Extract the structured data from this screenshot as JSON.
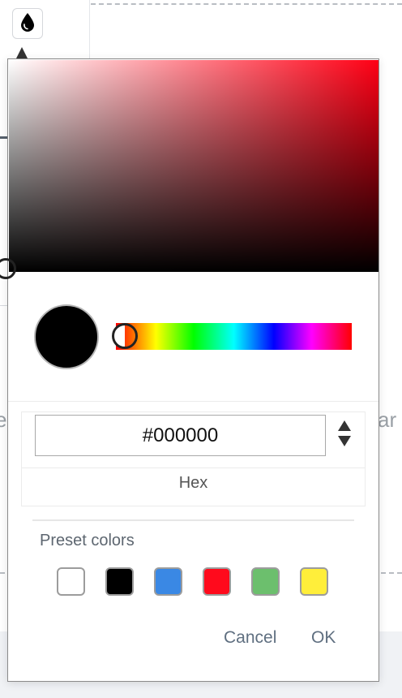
{
  "background": {
    "left_text": "e",
    "right_text": "ar"
  },
  "trigger": {
    "icon": "droplet-icon"
  },
  "color_picker": {
    "hue_color": "#ff0015",
    "selected_color": "#000000",
    "hex": {
      "value": "#000000",
      "label": "Hex"
    },
    "presets": {
      "title": "Preset colors",
      "colors": [
        "#ffffff",
        "#000000",
        "#3a88e4",
        "#ff0a1c",
        "#6cbf6d",
        "#ffee3a"
      ]
    },
    "actions": {
      "cancel": "Cancel",
      "ok": "OK"
    }
  }
}
